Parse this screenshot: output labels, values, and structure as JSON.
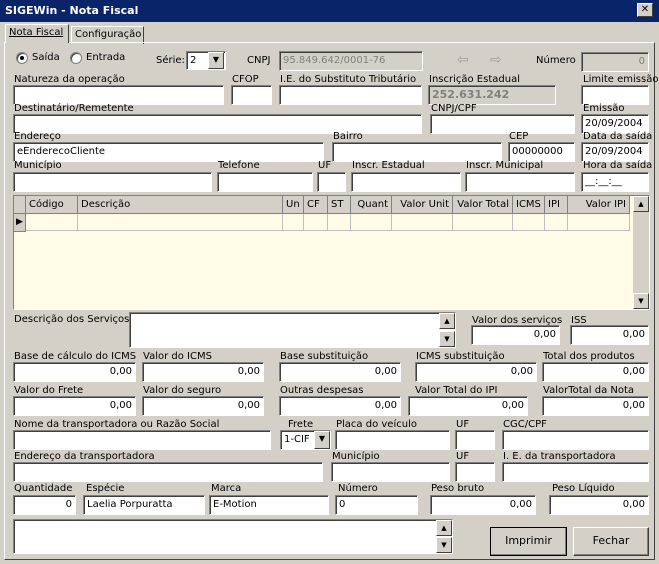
{
  "window": {
    "title": "SIGEWin - Nota Fiscal",
    "close": "✕"
  },
  "tabs": [
    {
      "label": "Nota Fiscal",
      "active": true
    },
    {
      "label": "Configuração",
      "active": false
    }
  ],
  "header": {
    "saida_label": "Saída",
    "entrada_label": "Entrada",
    "selected": "Saída",
    "serie_label": "Série:",
    "serie_value": "2",
    "cnpj_label": "CNPJ",
    "cnpj_value": "95.849.642/0001-76",
    "numero_label": "Número",
    "numero_value": "0"
  },
  "fields": {
    "natureza_label": "Natureza da operação",
    "natureza_value": "",
    "cfop_label": "CFOP",
    "cfop_value": "",
    "ie_sub_label": "I.E. do Substituto Tributário",
    "ie_sub_value": "",
    "insc_estadual_label": "Inscrição Estadual",
    "insc_estadual_value": "252.631.242",
    "limite_label": "Limite emissão",
    "limite_value": "",
    "destinatario_label": "Destinatário/Remetente",
    "destinatario_value": "",
    "cnpj_cpf_label": "CNPJ/CPF",
    "cnpj_cpf_value": "",
    "emissao_label": "Emissão",
    "emissao_value": "20/09/2004",
    "endereco_label": "Endereço",
    "endereco_value": "eEnderecoCliente",
    "bairro_label": "Bairro",
    "bairro_value": "",
    "cep_label": "CEP",
    "cep_value": "00000000",
    "data_saida_label": "Data da saída",
    "data_saida_value": "20/09/2004",
    "municipio_label": "Município",
    "municipio_value": "",
    "telefone_label": "Telefone",
    "telefone_value": "",
    "uf_label": "UF",
    "uf_value": "",
    "insc_estadual2_label": "Inscr. Estadual",
    "insc_estadual2_value": "",
    "insc_municipal_label": "Inscr. Municipal",
    "insc_municipal_value": "",
    "hora_saida_label": "Hora da saída",
    "hora_saida_value": "__:__:__"
  },
  "grid": {
    "columns": [
      "Código",
      "Descrição",
      "Un",
      "CF",
      "ST",
      "Quant",
      "Valor Unit",
      "Valor Total",
      "ICMS",
      "IPI",
      "Valor IPI"
    ]
  },
  "servicos": {
    "descricao_label": "Descrição dos Serviços",
    "descricao_value": "",
    "valor_servicos_label": "Valor dos serviços",
    "valor_servicos_value": "0,00",
    "iss_label": "ISS",
    "iss_value": "0,00"
  },
  "totais": {
    "base_icms_label": "Base de cálculo do ICMS",
    "base_icms_value": "0,00",
    "valor_icms_label": "Valor do ICMS",
    "valor_icms_value": "0,00",
    "base_sub_label": "Base substituição",
    "base_sub_value": "0,00",
    "icms_sub_label": "ICMS substituição",
    "icms_sub_value": "0,00",
    "total_produtos_label": "Total dos produtos",
    "total_produtos_value": "0,00",
    "valor_frete_label": "Valor do Frete",
    "valor_frete_value": "0,00",
    "valor_seguro_label": "Valor do seguro",
    "valor_seguro_value": "0,00",
    "outras_label": "Outras despesas",
    "outras_value": "0,00",
    "valor_ipi_label": "Valor Total do IPI",
    "valor_ipi_value": "0,00",
    "valor_nota_label": "ValorTotal da Nota",
    "valor_nota_value": "0,00"
  },
  "transporte": {
    "nome_label": "Nome da transportadora ou Razão Social",
    "nome_value": "",
    "frete_label": "Frete",
    "frete_value": "1-CIF",
    "placa_label": "Placa do veículo",
    "placa_value": "",
    "uf_label": "UF",
    "uf_value": "",
    "cgc_label": "CGC/CPF",
    "cgc_value": "",
    "endereco_label": "Endereço da transportadora",
    "endereco_value": "",
    "municipio_label": "Município",
    "municipio_value": "",
    "uf2_label": "UF",
    "uf2_value": "",
    "ie_label": "I. E. da transportadora",
    "ie_value": ""
  },
  "volumes": {
    "quantidade_label": "Quantidade",
    "quantidade_value": "0",
    "especie_label": "Espécie",
    "especie_value": "Laelia Porpuratta",
    "marca_label": "Marca",
    "marca_value": "E-Motion",
    "numero_label": "Número",
    "numero_value": "0",
    "peso_bruto_label": "Peso bruto",
    "peso_bruto_value": "0,00",
    "peso_liquido_label": "Peso Líquido",
    "peso_liquido_value": "0,00"
  },
  "buttons": {
    "imprimir": "Imprimir",
    "fechar": "Fechar"
  }
}
